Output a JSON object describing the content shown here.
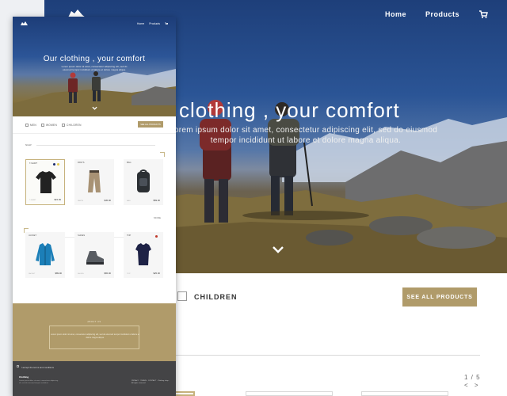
{
  "colors": {
    "accent": "#b09b6a",
    "hero_blue": "#2b5596",
    "footer": "#444446"
  },
  "desktop": {
    "nav": {
      "home": "Home",
      "products": "Products",
      "cart_icon": "cart-icon"
    },
    "hero": {
      "title": "clothing , your comfort",
      "subtitle": "orem ipsum dolor sit amet, consectetur adipiscing elit, sed do eiusmod tempor incididunt ut labore et dolore magna aliqua."
    },
    "filters": {
      "children": "CHILDREN"
    },
    "see_all": "SEE ALL PRODUCTS",
    "pager": {
      "label": "1 / 5",
      "arrows": "< >"
    }
  },
  "mobile": {
    "nav": {
      "home": "Home",
      "products": "Products"
    },
    "hero": {
      "title": "Our clothing , your comfort",
      "subtitle": "Lorem ipsum dolor sit amet, consectetur adipiscing elit, sed do eiusmod tempor incididunt ut labore et dolore magna aliqua."
    },
    "filters": {
      "men": "MEN",
      "women": "WOMEN",
      "children": "CHILDREN"
    },
    "see_all": "SEE ALL PRODUCTS",
    "section_new": "NEW",
    "more_link": "MORE",
    "products": [
      {
        "label": "T-SHIRT",
        "caption": "T-SHIRT",
        "price": "$15.99",
        "icon": "tshirt-icon",
        "selected": true
      },
      {
        "label": "PANTS",
        "caption": "PANTS",
        "price": "$45.00",
        "icon": "pants-icon",
        "selected": false
      },
      {
        "label": "BAG",
        "caption": "BAG",
        "price": "$59.00",
        "icon": "backpack-icon",
        "selected": false
      },
      {
        "label": "JACKET",
        "caption": "JACKET",
        "price": "$89.00",
        "icon": "jacket-icon",
        "selected": false
      },
      {
        "label": "SHOES",
        "caption": "SHOES",
        "price": "$65.00",
        "icon": "boot-icon",
        "selected": false
      },
      {
        "label": "TOP",
        "caption": "TOP",
        "price": "$25.00",
        "icon": "top-icon",
        "selected": false
      }
    ],
    "band": {
      "title": "ABOUT US",
      "text": "Lorem ipsum dolor sit amet, consectetur adipiscing elit, sed do eiusmod tempor incididunt ut labore et dolore magna aliqua."
    },
    "footer": {
      "notice": "I accept the terms and conditions",
      "heading": "Clothing",
      "text": "Lorem ipsum dolor sit amet, consectetur adipiscing elit, sed do eiusmod tempor incididunt.",
      "links": "PRIVACY · TERMS · CONTACT · Clothing shop · All rights reserved"
    }
  }
}
